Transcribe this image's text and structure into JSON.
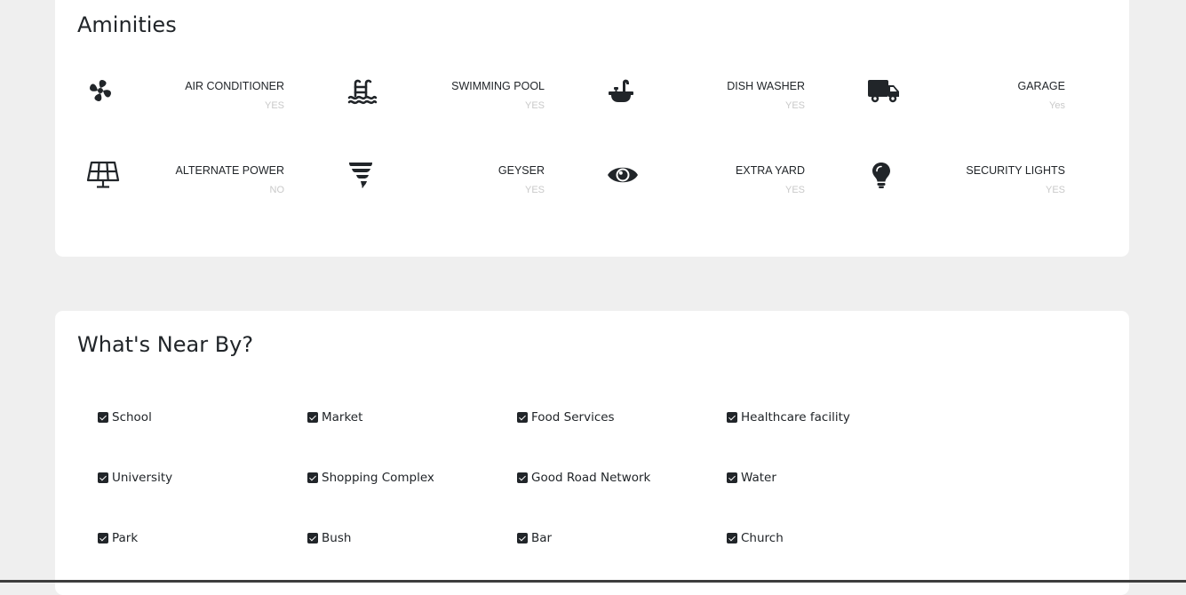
{
  "amenities": {
    "title": "Aminities",
    "items": [
      {
        "icon": "fan-icon",
        "label": "AIR CONDITIONER",
        "value": "YES"
      },
      {
        "icon": "swimming-pool-icon",
        "label": "SWIMMING POOL",
        "value": "YES"
      },
      {
        "icon": "sink-icon",
        "label": "DISH WASHER",
        "value": "YES"
      },
      {
        "icon": "truck-icon",
        "label": "GARAGE",
        "value": "Yes"
      },
      {
        "icon": "solar-panel-icon",
        "label": "ALTERNATE POWER",
        "value": "NO"
      },
      {
        "icon": "tornado-icon",
        "label": "GEYSER",
        "value": "YES"
      },
      {
        "icon": "eye-icon",
        "label": "EXTRA YARD",
        "value": "YES"
      },
      {
        "icon": "lightbulb-icon",
        "label": "SECURITY LIGHTS",
        "value": "YES"
      }
    ]
  },
  "nearby": {
    "title": "What's Near By?",
    "items": [
      "School",
      "Market",
      "Food Services",
      "Healthcare facility",
      "University",
      "Shopping Complex",
      "Good Road Network",
      "Water",
      "Park",
      "Bush",
      "Bar",
      "Church"
    ]
  }
}
